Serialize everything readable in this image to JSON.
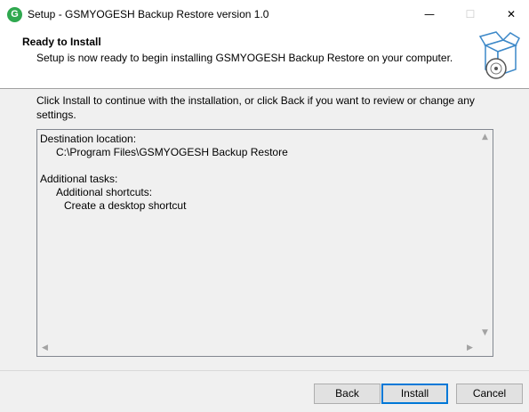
{
  "window": {
    "icon_letter": "G",
    "title": "Setup - GSMYOGESH Backup Restore version 1.0",
    "controls": {
      "minimize": "—",
      "maximize": "☐",
      "close": "✕"
    }
  },
  "header": {
    "title": "Ready to Install",
    "subtitle": "Setup is now ready to begin installing GSMYOGESH Backup Restore on your computer."
  },
  "body": {
    "instruction": "Click Install to continue with the installation, or click Back if you want to review or change any settings."
  },
  "summary": {
    "lines": [
      "Destination location:",
      "C:\\Program Files\\GSMYOGESH Backup Restore",
      "",
      "Additional tasks:",
      "Additional shortcuts:",
      "Create a desktop shortcut"
    ]
  },
  "scroll": {
    "up": "▲",
    "down": "▼",
    "left": "◀",
    "right": "▶"
  },
  "buttons": {
    "back": "Back",
    "install": "Install",
    "cancel": "Cancel"
  }
}
